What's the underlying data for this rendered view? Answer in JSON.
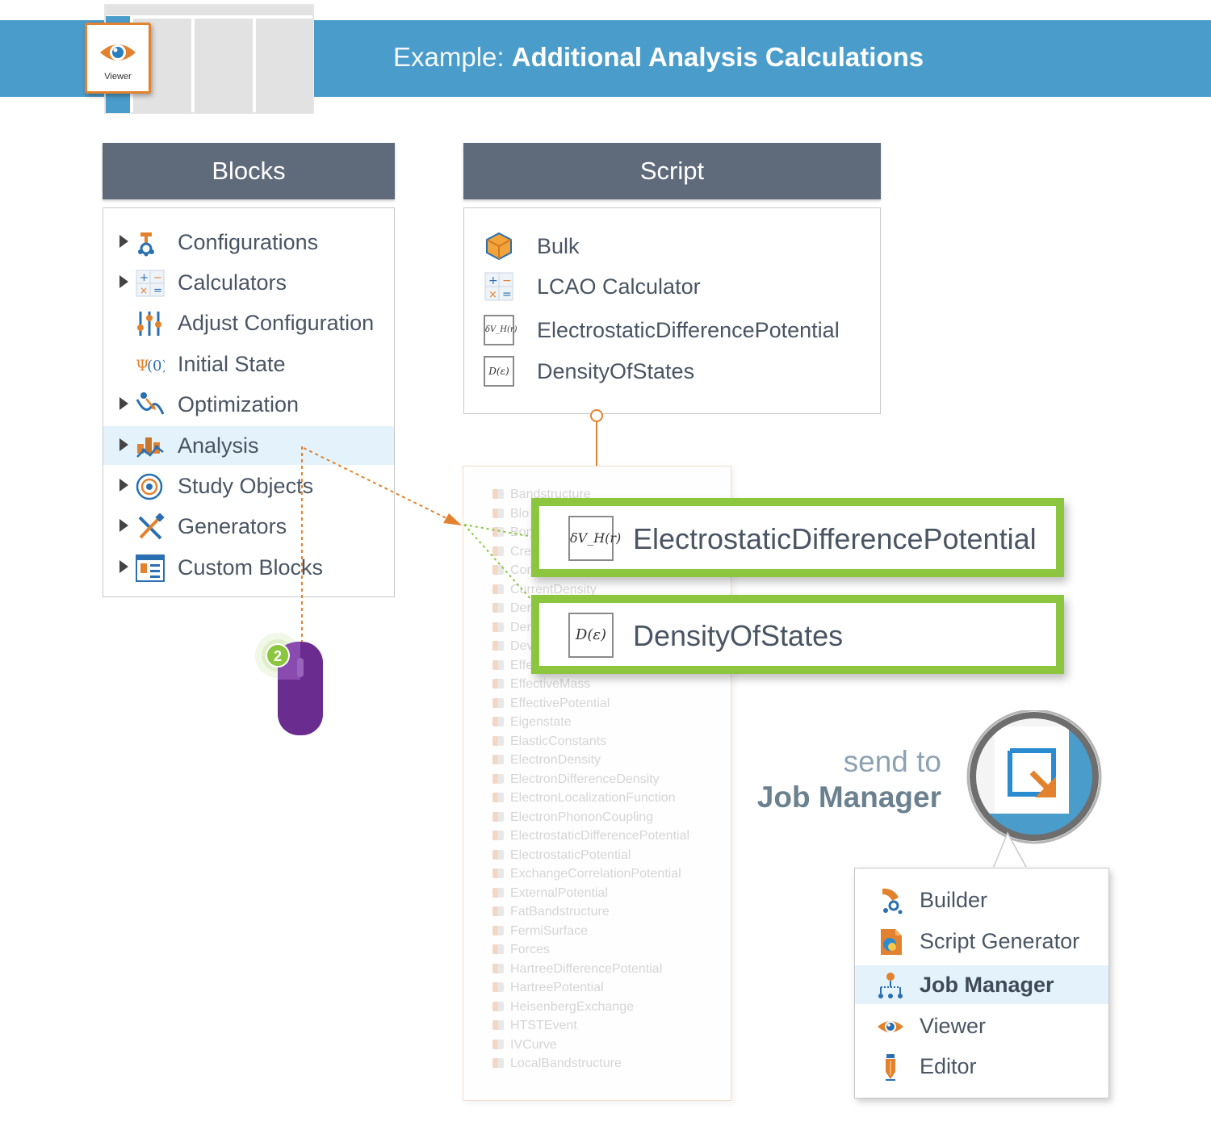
{
  "banner": {
    "prefix": "Example: ",
    "title": "Additional Analysis Calculations"
  },
  "viewer_tile": {
    "label": "Viewer"
  },
  "blocks": {
    "header": "Blocks",
    "items": [
      {
        "label": "Configurations",
        "icon": "configurations-icon",
        "expandable": true
      },
      {
        "label": "Calculators",
        "icon": "calculators-icon",
        "expandable": true
      },
      {
        "label": "Adjust Configuration",
        "icon": "sliders-icon",
        "expandable": false
      },
      {
        "label": "Initial State",
        "icon": "psi-zero-icon",
        "expandable": false
      },
      {
        "label": "Optimization",
        "icon": "optimization-icon",
        "expandable": true
      },
      {
        "label": "Analysis",
        "icon": "analysis-icon",
        "expandable": true,
        "selected": true
      },
      {
        "label": "Study Objects",
        "icon": "target-icon",
        "expandable": true
      },
      {
        "label": "Generators",
        "icon": "tools-icon",
        "expandable": true
      },
      {
        "label": "Custom Blocks",
        "icon": "custom-blocks-icon",
        "expandable": true
      }
    ]
  },
  "script": {
    "header": "Script",
    "items": [
      {
        "label": "Bulk",
        "icon": "bulk-cube-icon"
      },
      {
        "label": "LCAO Calculator",
        "icon": "calculators-icon"
      },
      {
        "label": "ElectrostaticDifferencePotential",
        "icon": "formula-icon",
        "formula": "δV_H(r)"
      },
      {
        "label": "DensityOfStates",
        "icon": "formula-icon",
        "formula": "D(ε)"
      }
    ]
  },
  "analysis_list": {
    "items": [
      "Bandstructure",
      "Blo",
      "Bon",
      "Cre",
      "Con",
      "CurrentDensity",
      "Den",
      "Den",
      "Dev",
      "Effe",
      "EffectiveMass",
      "EffectivePotential",
      "Eigenstate",
      "ElasticConstants",
      "ElectronDensity",
      "ElectronDifferenceDensity",
      "ElectronLocalizationFunction",
      "ElectronPhononCoupling",
      "ElectrostaticDifferencePotential",
      "ElectrostaticPotential",
      "ExchangeCorrelationPotential",
      "ExternalPotential",
      "FatBandstructure",
      "FermiSurface",
      "Forces",
      "HartreeDifferencePotential",
      "HartreePotential",
      "HeisenbergExchange",
      "HTSTEvent",
      "IVCurve",
      "LocalBandstructure"
    ]
  },
  "highlighted": [
    {
      "label": "ElectrostaticDifferencePotential",
      "formula": "δV_H(r)"
    },
    {
      "label": "DensityOfStates",
      "formula": "D(ε)"
    }
  ],
  "mouse": {
    "step": "2"
  },
  "send_to": {
    "line1": "send to",
    "line2": "Job Manager"
  },
  "app_menu": {
    "items": [
      {
        "label": "Builder",
        "icon": "builder-icon"
      },
      {
        "label": "Script Generator",
        "icon": "script-generator-icon"
      },
      {
        "label": "Job Manager",
        "icon": "job-manager-icon",
        "selected": true
      },
      {
        "label": "Viewer",
        "icon": "eye-icon"
      },
      {
        "label": "Editor",
        "icon": "editor-icon"
      }
    ]
  },
  "colors": {
    "banner": "#4a9ccb",
    "panel_header": "#5f6b7b",
    "highlight_green": "#8cc63f",
    "accent_orange": "#e2822e",
    "selection": "#e3f2fb",
    "mouse_purple": "#6a2c8e"
  }
}
